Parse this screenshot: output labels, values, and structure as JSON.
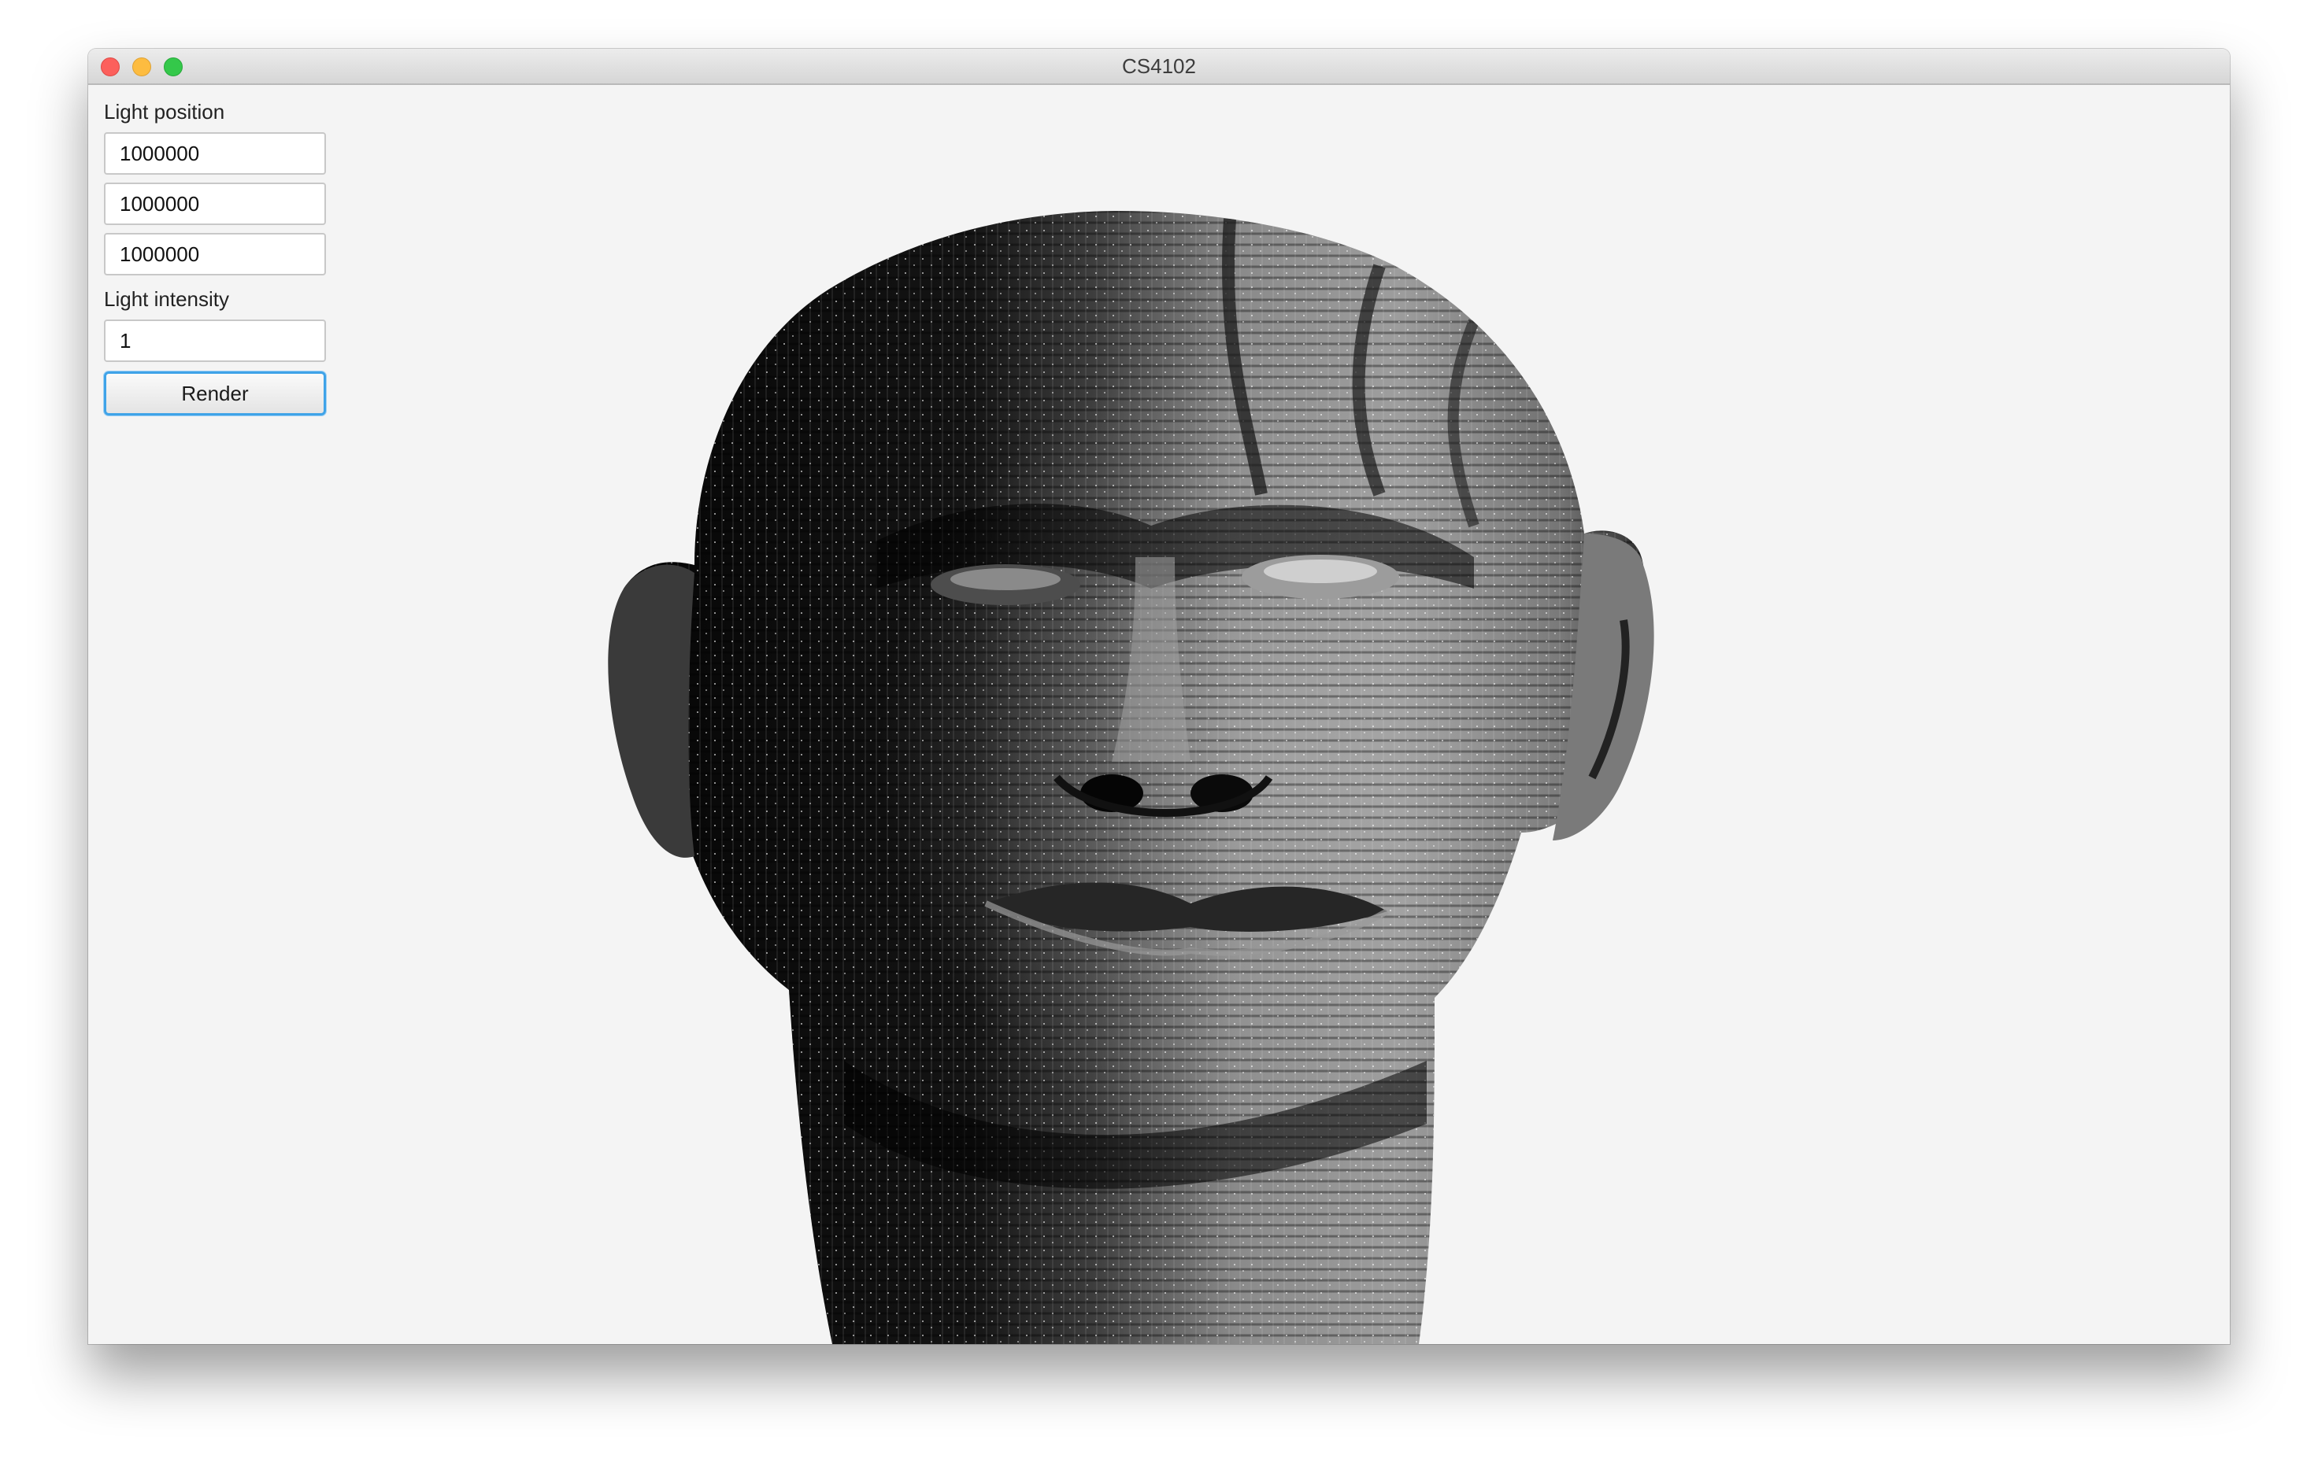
{
  "window": {
    "title": "CS4102"
  },
  "controls": {
    "light_position_label": "Light position",
    "light_x": "1000000",
    "light_y": "1000000",
    "light_z": "1000000",
    "light_intensity_label": "Light intensity",
    "light_intensity": "1",
    "render_label": "Render"
  },
  "colors": {
    "window_background": "#f4f4f4",
    "focus_accent": "#3fa3e8",
    "traffic_close": "#fc605c",
    "traffic_minimize": "#fdbc40",
    "traffic_zoom": "#34c84a"
  },
  "render": {
    "content": "grayscale shaded 3D head mesh"
  }
}
